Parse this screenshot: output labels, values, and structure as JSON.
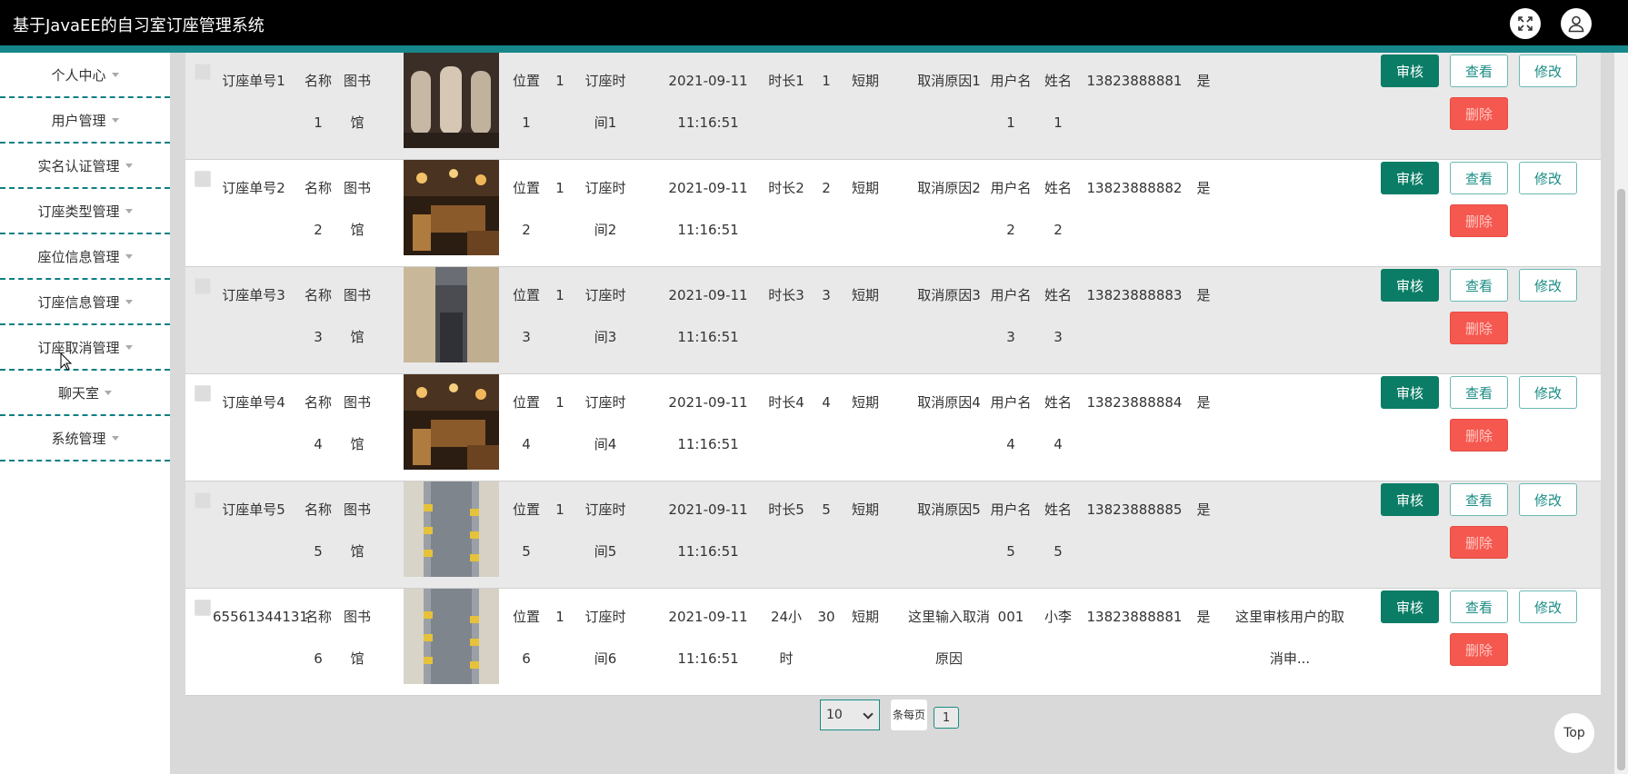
{
  "header": {
    "title": "基于JavaEE的自习室订座管理系统"
  },
  "sidebar": {
    "items": [
      {
        "label": "个人中心"
      },
      {
        "label": "用户管理"
      },
      {
        "label": "实名认证管理"
      },
      {
        "label": "订座类型管理"
      },
      {
        "label": "座位信息管理"
      },
      {
        "label": "订座信息管理"
      },
      {
        "label": "订座取消管理"
      },
      {
        "label": "聊天室"
      },
      {
        "label": "系统管理"
      }
    ]
  },
  "table": {
    "rows": [
      {
        "order_no": "订座单号1",
        "name_a": "名称",
        "name_b": "1",
        "lib_a": "图书",
        "lib_b": "馆",
        "image": "booth-seats",
        "pos_a": "位置",
        "pos_b": "1",
        "n1": "1",
        "time_label_a": "订座时",
        "time_label_b": "间1",
        "date": "2021-09-11",
        "time": "11:16:51",
        "dur_a": "时长1",
        "dur_b": "",
        "dur_n": "1",
        "term": "短期",
        "reason_a": "取消原因1",
        "reason_b": "",
        "user_a": "用户名",
        "user_b": "1",
        "fname_a": "姓名",
        "fname_b": "1",
        "phone": "13823888881",
        "approved": "是",
        "reply_a": "",
        "reply_b": ""
      },
      {
        "order_no": "订座单号2",
        "name_a": "名称",
        "name_b": "2",
        "lib_a": "图书",
        "lib_b": "馆",
        "image": "cafe-interior",
        "pos_a": "位置",
        "pos_b": "2",
        "n1": "1",
        "time_label_a": "订座时",
        "time_label_b": "间2",
        "date": "2021-09-11",
        "time": "11:16:51",
        "dur_a": "时长2",
        "dur_b": "",
        "dur_n": "2",
        "term": "短期",
        "reason_a": "取消原因2",
        "reason_b": "",
        "user_a": "用户名",
        "user_b": "2",
        "fname_a": "姓名",
        "fname_b": "2",
        "phone": "13823888882",
        "approved": "是",
        "reply_a": "",
        "reply_b": ""
      },
      {
        "order_no": "订座单号3",
        "name_a": "名称",
        "name_b": "3",
        "lib_a": "图书",
        "lib_b": "馆",
        "image": "corridor",
        "pos_a": "位置",
        "pos_b": "3",
        "n1": "1",
        "time_label_a": "订座时",
        "time_label_b": "间3",
        "date": "2021-09-11",
        "time": "11:16:51",
        "dur_a": "时长3",
        "dur_b": "",
        "dur_n": "3",
        "term": "短期",
        "reason_a": "取消原因3",
        "reason_b": "",
        "user_a": "用户名",
        "user_b": "3",
        "fname_a": "姓名",
        "fname_b": "3",
        "phone": "13823888883",
        "approved": "是",
        "reply_a": "",
        "reply_b": ""
      },
      {
        "order_no": "订座单号4",
        "name_a": "名称",
        "name_b": "4",
        "lib_a": "图书",
        "lib_b": "馆",
        "image": "cafe-interior",
        "pos_a": "位置",
        "pos_b": "4",
        "n1": "1",
        "time_label_a": "订座时",
        "time_label_b": "间4",
        "date": "2021-09-11",
        "time": "11:16:51",
        "dur_a": "时长4",
        "dur_b": "",
        "dur_n": "4",
        "term": "短期",
        "reason_a": "取消原因4",
        "reason_b": "",
        "user_a": "用户名",
        "user_b": "4",
        "fname_a": "姓名",
        "fname_b": "4",
        "phone": "13823888884",
        "approved": "是",
        "reply_a": "",
        "reply_b": ""
      },
      {
        "order_no": "订座单号5",
        "name_a": "名称",
        "name_b": "5",
        "lib_a": "图书",
        "lib_b": "馆",
        "image": "study-hall",
        "pos_a": "位置",
        "pos_b": "5",
        "n1": "1",
        "time_label_a": "订座时",
        "time_label_b": "间5",
        "date": "2021-09-11",
        "time": "11:16:51",
        "dur_a": "时长5",
        "dur_b": "",
        "dur_n": "5",
        "term": "短期",
        "reason_a": "取消原因5",
        "reason_b": "",
        "user_a": "用户名",
        "user_b": "5",
        "fname_a": "姓名",
        "fname_b": "5",
        "phone": "13823888885",
        "approved": "是",
        "reply_a": "",
        "reply_b": ""
      },
      {
        "order_no": "65561344131",
        "name_a": "名称",
        "name_b": "6",
        "lib_a": "图书",
        "lib_b": "馆",
        "image": "study-hall",
        "pos_a": "位置",
        "pos_b": "6",
        "n1": "1",
        "time_label_a": "订座时",
        "time_label_b": "间6",
        "date": "2021-09-11",
        "time": "11:16:51",
        "dur_a": "24小",
        "dur_b": "时",
        "dur_n": "30",
        "term": "短期",
        "reason_a": "这里输入取消",
        "reason_b": "原因",
        "user_a": "001",
        "user_b": "",
        "fname_a": "小李",
        "fname_b": "",
        "phone": "13823888881",
        "approved": "是",
        "reply_a": "这里审核用户的取",
        "reply_b": "消申..."
      }
    ],
    "actions": {
      "audit": "审核",
      "view": "查看",
      "edit": "修改",
      "delete": "删除"
    }
  },
  "pager": {
    "page_size": "10",
    "per_page_label": "条每页",
    "current_page": "1"
  },
  "top_button": "Top",
  "colors": {
    "accent": "#17878a",
    "audit": "#0b7d66",
    "delete": "#f5584f"
  }
}
